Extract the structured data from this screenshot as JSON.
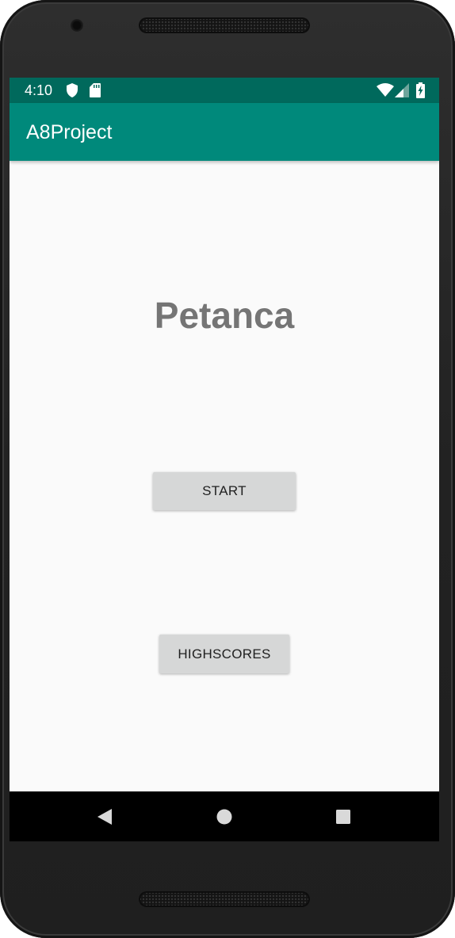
{
  "status_bar": {
    "time": "4:10",
    "icons": [
      "shield-icon",
      "sd-card-icon",
      "wifi-icon",
      "cell-signal-icon",
      "battery-charging-icon"
    ]
  },
  "app_bar": {
    "title": "A8Project"
  },
  "main": {
    "heading": "Petanca",
    "start_button": "START",
    "highscores_button": "HIGHSCORES"
  },
  "nav_bar": {
    "icons": [
      "back-icon",
      "home-icon",
      "recents-icon"
    ]
  },
  "colors": {
    "status_bar": "#00695c",
    "app_bar": "#00897b",
    "background": "#fafafa",
    "heading_text": "#757575",
    "button": "#d6d7d7",
    "nav_bar": "#000000"
  }
}
